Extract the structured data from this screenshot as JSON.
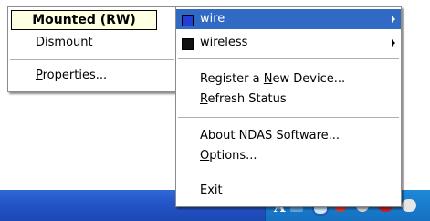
{
  "left_menu": {
    "mounted": "Mounted (RW)",
    "dismount_pre": "Dism",
    "dismount_u": "o",
    "dismount_post": "unt",
    "properties_pre": "",
    "properties_u": "P",
    "properties_post": "roperties..."
  },
  "right_menu": {
    "wire": "wire",
    "wireless": "wireless",
    "register_pre": "Register a ",
    "register_u": "N",
    "register_post": "ew Device...",
    "refresh_pre": "",
    "refresh_u": "R",
    "refresh_post": "efresh Status",
    "about": "About NDAS Software...",
    "options_pre": "",
    "options_u": "O",
    "options_post": "ptions...",
    "exit_pre": "E",
    "exit_u": "x",
    "exit_post": "it"
  },
  "tray": {
    "lang": "A"
  },
  "colors": {
    "highlight": "#316ac5",
    "wire_swatch": "#1f3fd6",
    "wireless_swatch": "#111111",
    "tooltip_bg": "#ffffe1"
  }
}
